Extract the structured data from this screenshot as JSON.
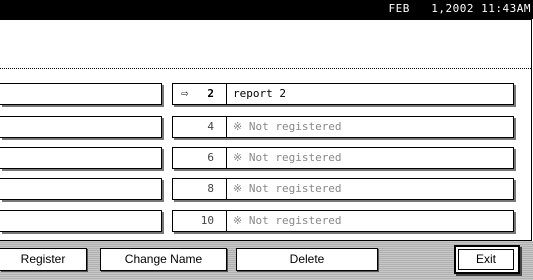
{
  "status_bar": {
    "datetime": "FEB   1,2002 11:43AM"
  },
  "entries": [
    {
      "number": "2",
      "name": "report 2",
      "selected": true
    },
    {
      "number": "4",
      "name": "※ Not registered",
      "selected": false
    },
    {
      "number": "6",
      "name": "※ Not registered",
      "selected": false
    },
    {
      "number": "8",
      "name": "※ Not registered",
      "selected": false
    },
    {
      "number": "10",
      "name": "※ Not registered",
      "selected": false
    }
  ],
  "toolbar": {
    "register_label": "Register",
    "change_name_label": "Change Name",
    "delete_label": "Delete",
    "exit_label": "Exit"
  },
  "icons": {
    "selected_marker": "arrow-right-circle-icon"
  }
}
